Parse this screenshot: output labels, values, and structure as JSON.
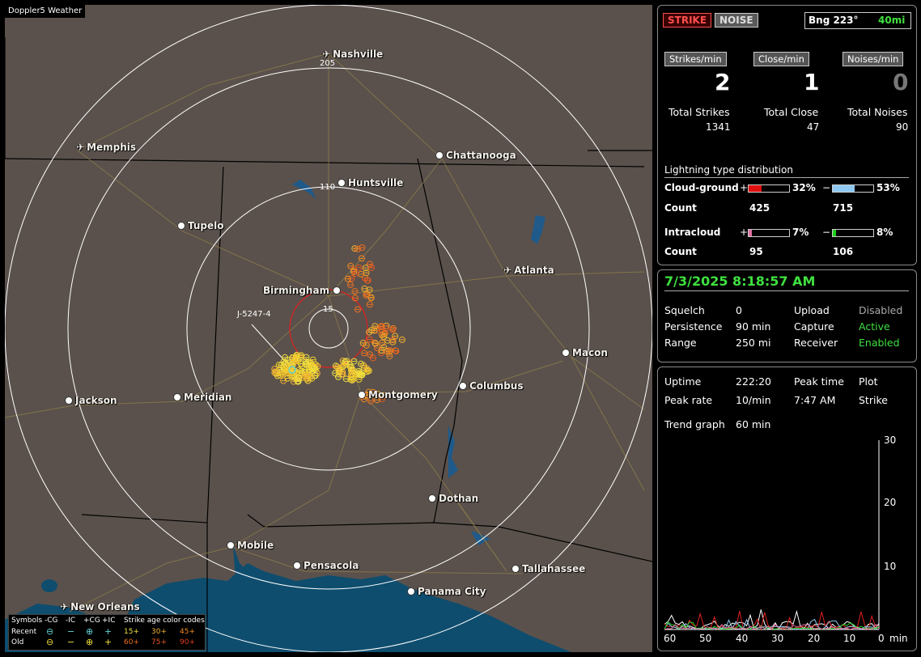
{
  "map": {
    "title": "Doppler5 Weather",
    "cities": [
      {
        "name": "Nashville",
        "type": "airport"
      },
      {
        "name": "Memphis",
        "type": "airport"
      },
      {
        "name": "Chattanooga",
        "type": "city"
      },
      {
        "name": "Huntsville",
        "type": "city"
      },
      {
        "name": "Tupelo",
        "type": "city"
      },
      {
        "name": "Atlanta",
        "type": "airport"
      },
      {
        "name": "Birmingham",
        "type": "city"
      },
      {
        "name": "Macon",
        "type": "city"
      },
      {
        "name": "Jackson",
        "type": "city"
      },
      {
        "name": "Meridian",
        "type": "city"
      },
      {
        "name": "Montgomery",
        "type": "city"
      },
      {
        "name": "Columbus",
        "type": "city"
      },
      {
        "name": "Dothan",
        "type": "city"
      },
      {
        "name": "Mobile",
        "type": "city"
      },
      {
        "name": "Pensacola",
        "type": "city"
      },
      {
        "name": "Tallahassee",
        "type": "city"
      },
      {
        "name": "Panama City",
        "type": "city"
      },
      {
        "name": "New Orleans",
        "type": "airport"
      }
    ],
    "range_labels": [
      "205",
      "110",
      "15"
    ],
    "strike_tag": "J-5247-4",
    "colors": {
      "land": "#5a514c",
      "water": "#0e4d6e",
      "rings": "#ffffff",
      "roads": "#8a7a4a"
    }
  },
  "legend": {
    "symbols_label": "Symbols",
    "columns": [
      "-CG",
      "-IC",
      "+CG",
      "+IC"
    ],
    "age_title": "Strike age color codes",
    "recent_label": "Recent",
    "old_label": "Old",
    "recent_ages": [
      "15+",
      "30+",
      "45+"
    ],
    "old_ages": [
      "60+",
      "75+",
      "90+"
    ]
  },
  "top": {
    "strike_button": "STRIKE",
    "noise_button": "NOISE",
    "bearing": "Bng 223°",
    "distance": "40mi",
    "rates": [
      {
        "label": "Strikes/min",
        "value": "2",
        "total_label": "Total Strikes",
        "total": "1341"
      },
      {
        "label": "Close/min",
        "value": "1",
        "total_label": "Total Close",
        "total": "47"
      },
      {
        "label": "Noises/min",
        "value": "0",
        "total_label": "Total Noises",
        "total": "90"
      }
    ],
    "dist_title": "Lightning type distribution",
    "cloud_ground": {
      "label": "Cloud-ground",
      "pos_pct": "32%",
      "neg_pct": "53%",
      "pos_frac": 0.32,
      "neg_frac": 0.53,
      "count_label": "Count",
      "pos_count": "425",
      "neg_count": "715"
    },
    "intracloud": {
      "label": "Intracloud",
      "pos_pct": "7%",
      "neg_pct": "8%",
      "pos_frac": 0.07,
      "neg_frac": 0.08,
      "count_label": "Count",
      "pos_count": "95",
      "neg_count": "106"
    }
  },
  "status": {
    "datetime": "7/3/2025 8:18:57 AM",
    "rows": [
      {
        "k1": "Squelch",
        "v1": "0",
        "k2": "Upload",
        "v2": "Disabled"
      },
      {
        "k1": "Persistence",
        "v1": "90 min",
        "k2": "Capture",
        "v2": "Active"
      },
      {
        "k1": "Range",
        "v1": "250 mi",
        "k2": "Receiver",
        "v2": "Enabled"
      }
    ]
  },
  "trend": {
    "uptime_label": "Uptime",
    "uptime": "222:20",
    "peak_time_label": "Peak time",
    "peak_time": "7:47 AM",
    "plot_label": "Plot",
    "plot": "Strike",
    "peak_rate_label": "Peak rate",
    "peak_rate": "10/min",
    "graph_label": "Trend graph",
    "graph_window": "60 min",
    "y_ticks": [
      "30",
      "20",
      "10"
    ],
    "x_ticks": [
      "60",
      "50",
      "40",
      "30",
      "20",
      "10",
      "0"
    ],
    "x_unit": "min"
  }
}
